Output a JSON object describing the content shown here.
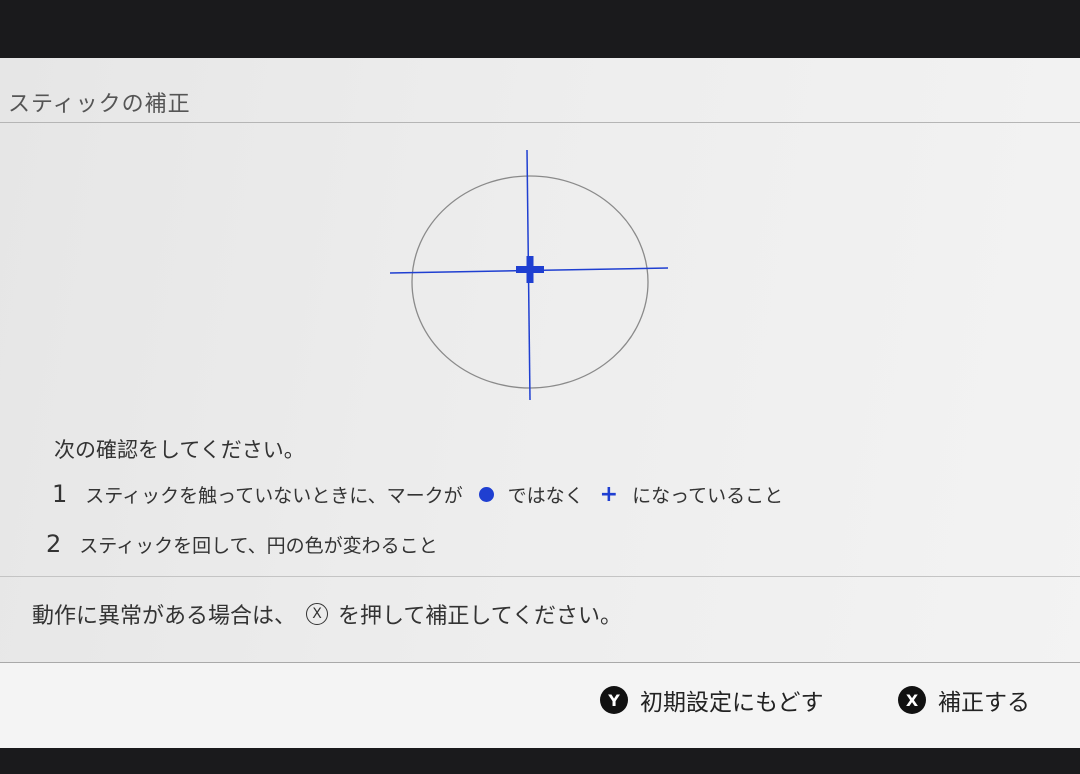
{
  "header": {
    "title": "スティックの補正"
  },
  "stick": {
    "crosshair_color": "#1f3fd1",
    "circle_color": "#8a8a8a",
    "center_icon": "plus-icon"
  },
  "instructions": {
    "lead": "次の確認をしてください。",
    "step1": {
      "num": "1",
      "text_before": "スティックを触っていないときに、マークが",
      "text_middle": "ではなく",
      "text_after": "になっていること",
      "marker_icon": "blue-dot-icon",
      "plus": "+"
    },
    "step2": {
      "num": "2",
      "text": "スティックを回して、円の色が変わること"
    }
  },
  "notice": {
    "text_before": "動作に異常がある場合は、",
    "button_glyph": "X",
    "text_after": "を押して補正してください。"
  },
  "footer": {
    "reset": {
      "badge": "Y",
      "label": "初期設定にもどす"
    },
    "calibrate": {
      "badge": "X",
      "label": "補正する"
    }
  },
  "colors": {
    "accent": "#1f3fd1",
    "background": "#ececec",
    "text": "#333333"
  }
}
